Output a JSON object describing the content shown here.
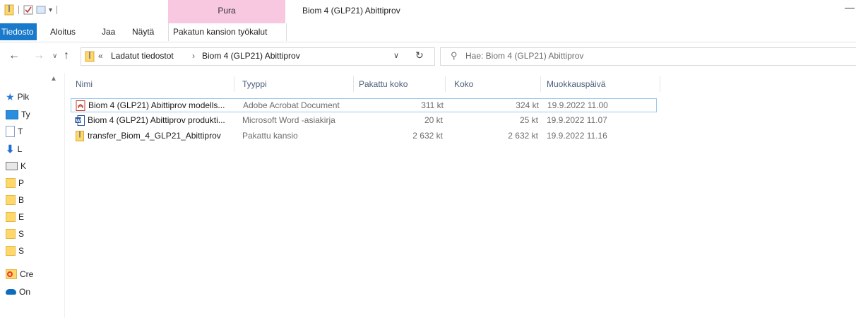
{
  "window": {
    "title": "Biom 4 (GLP21) Abittiprov",
    "contextual_tab": "Pura",
    "minimize_glyph": "—"
  },
  "ribbon": {
    "tabs": [
      "Tiedosto",
      "Aloitus",
      "Jaa",
      "Näytä",
      "Pakatun kansion työkalut"
    ]
  },
  "address": {
    "overflow": "«",
    "crumbs": [
      "Ladatut tiedostot",
      "Biom 4 (GLP21) Abittiprov"
    ],
    "separator": "›"
  },
  "search": {
    "placeholder": "Hae: Biom 4 (GLP21) Abittiprov"
  },
  "nav_pane": {
    "items": [
      {
        "label": "Pik",
        "icon": "star-icon"
      },
      {
        "label": "Ty",
        "icon": "desktop-icon"
      },
      {
        "label": "T",
        "icon": "document-icon"
      },
      {
        "label": "L",
        "icon": "download-icon"
      },
      {
        "label": "K",
        "icon": "pictures-icon"
      },
      {
        "label": "P",
        "icon": "folder-icon"
      },
      {
        "label": "B",
        "icon": "folder-icon"
      },
      {
        "label": "E",
        "icon": "folder-icon"
      },
      {
        "label": "S",
        "icon": "folder-icon"
      },
      {
        "label": "S",
        "icon": "folder-icon"
      },
      {
        "label": "Cre",
        "icon": "creative-cloud-icon"
      },
      {
        "label": "On",
        "icon": "onedrive-icon"
      }
    ]
  },
  "columns": [
    "Nimi",
    "Tyyppi",
    "Pakattu koko",
    "Koko",
    "Muokkauspäivä"
  ],
  "files": [
    {
      "name": "Biom 4 (GLP21) Abittiprov modells...",
      "type": "Adobe Acrobat Document",
      "packed": "311 kt",
      "size": "324 kt",
      "modified": "19.9.2022 11.00",
      "icon": "pdf-icon"
    },
    {
      "name": "Biom 4 (GLP21) Abittiprov produkti...",
      "type": "Microsoft Word -asiakirja",
      "packed": "20 kt",
      "size": "25 kt",
      "modified": "19.9.2022 11.07",
      "icon": "word-doc-icon"
    },
    {
      "name": "transfer_Biom_4_GLP21_Abittiprov",
      "type": "Pakattu kansio",
      "packed": "2 632 kt",
      "size": "2 632 kt",
      "modified": "19.9.2022 11.16",
      "icon": "zip-folder-icon"
    }
  ],
  "colors": {
    "file_tab": "#1979ca",
    "contextual_tab": "#f8c8e0",
    "header_text": "#4c607a",
    "selection_border": "#99c9ef"
  }
}
